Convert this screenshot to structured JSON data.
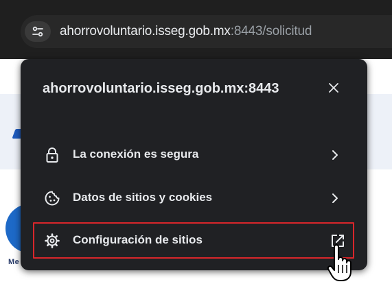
{
  "address_bar": {
    "host": "ahorrovoluntario.isseg.gob.mx",
    "port_path": ":8443/solicitud"
  },
  "popup": {
    "title": "ahorrovoluntario.isseg.gob.mx:8443",
    "items": [
      {
        "label": "La conexión es segura",
        "icon": "lock-icon",
        "trailing": "chevron-right-icon"
      },
      {
        "label": "Datos de sitios y cookies",
        "icon": "cookie-icon",
        "trailing": "chevron-right-icon"
      },
      {
        "label": "Configuración de sitios",
        "icon": "gear-icon",
        "trailing": "open-external-icon",
        "highlight_color": "#d9262b"
      }
    ]
  },
  "background_page": {
    "fragment_left": "Me"
  },
  "colors": {
    "chrome_bg": "#1f1f1f",
    "popup_bg": "#202124",
    "text": "#e8eaed",
    "url_dim": "#9aa0a6",
    "highlight": "#d9262b"
  }
}
